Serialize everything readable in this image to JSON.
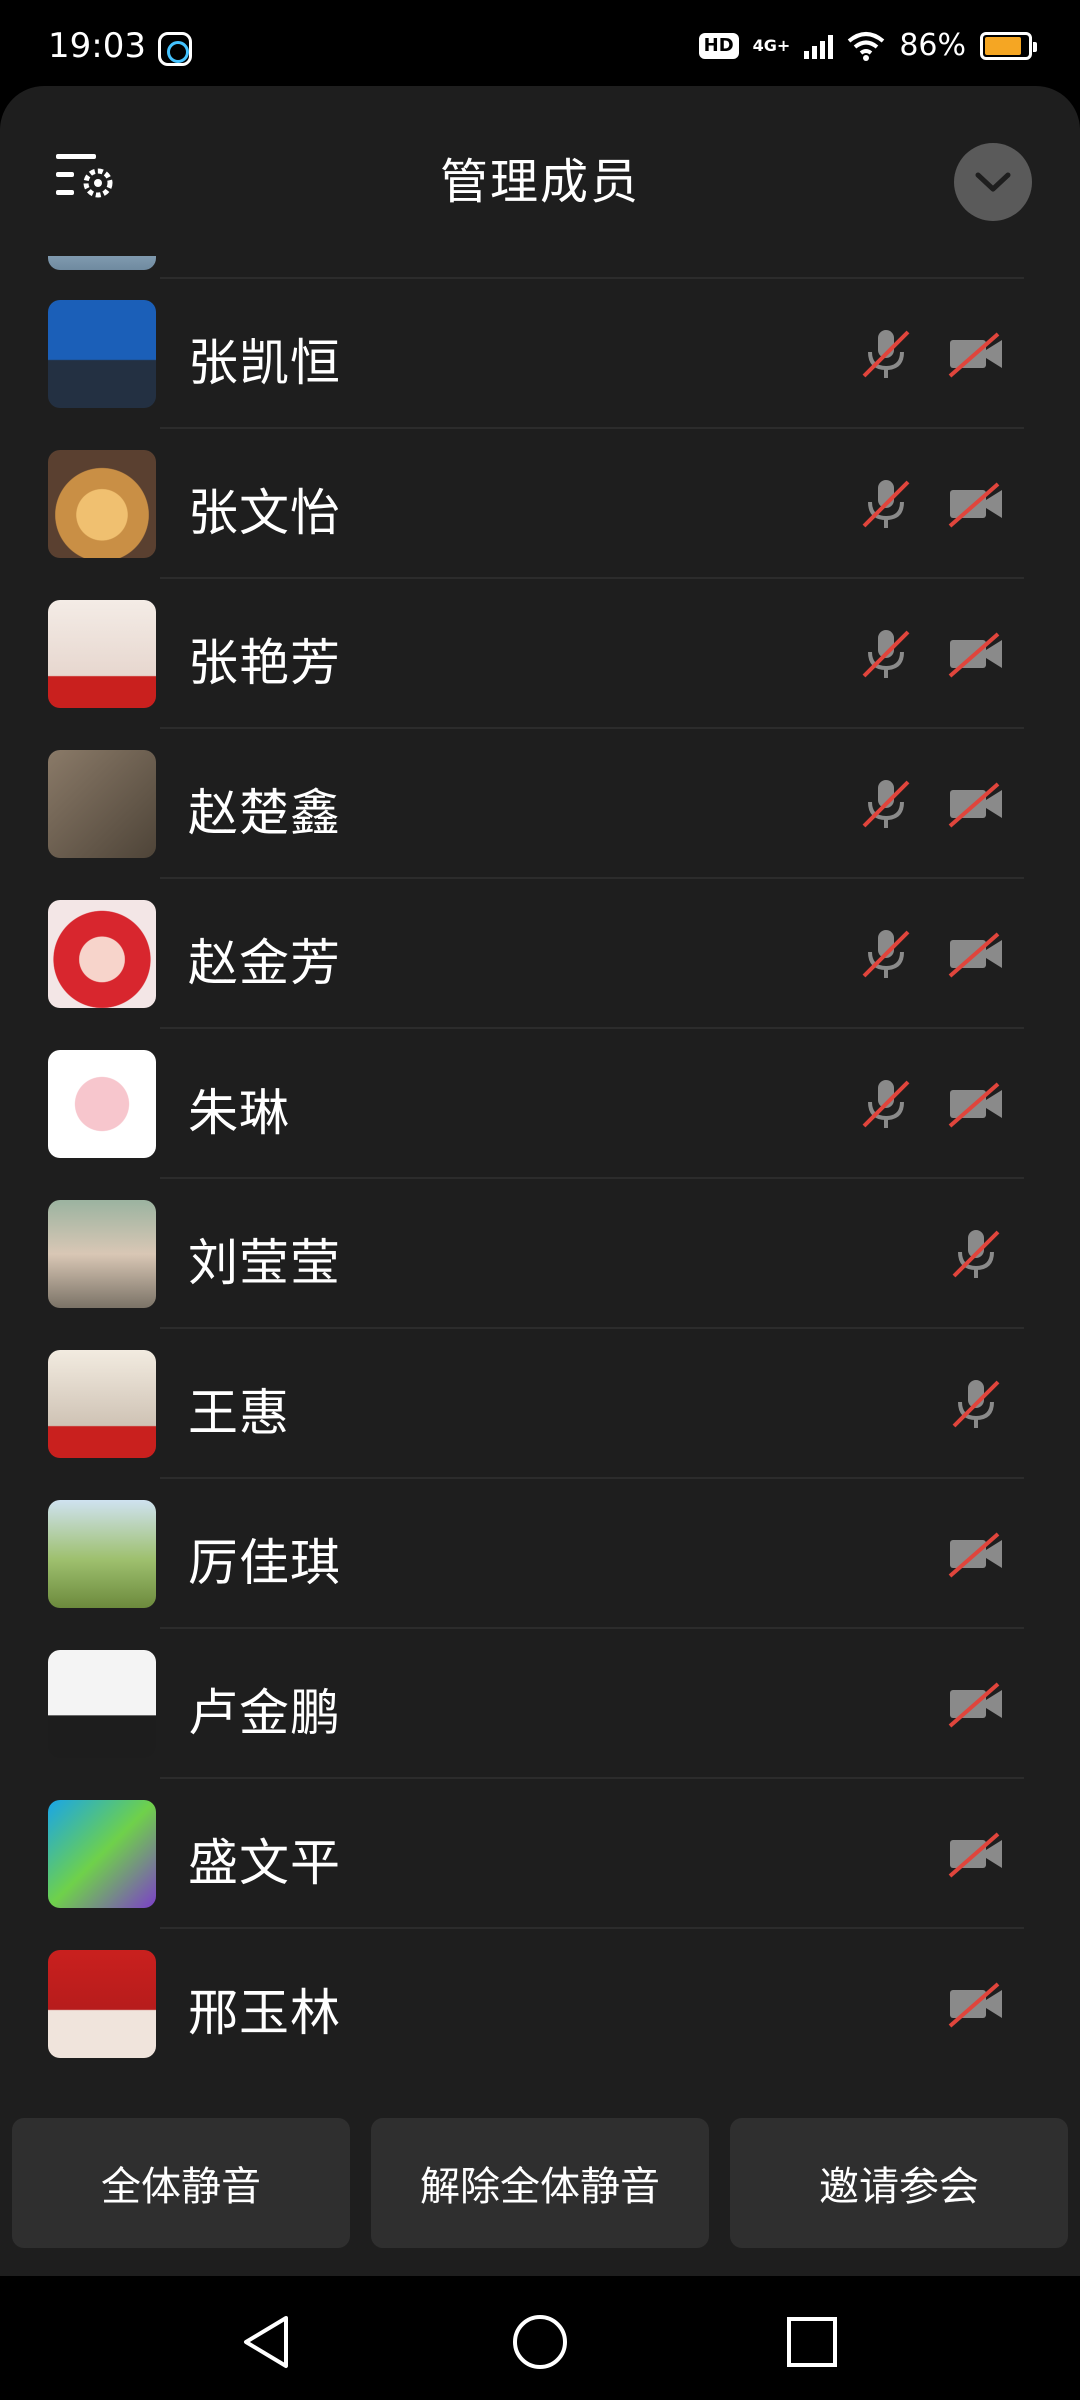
{
  "status_bar": {
    "time": "19:03",
    "hd": "HD",
    "network": "4G+",
    "battery": "86%",
    "battery_level": 0.86
  },
  "header": {
    "title": "管理成员",
    "settings_icon": "list-settings-icon",
    "collapse_icon": "chevron-down-icon"
  },
  "members": [
    {
      "name": "张凯恒",
      "mic_muted": true,
      "camera_off": true
    },
    {
      "name": "张文怡",
      "mic_muted": true,
      "camera_off": true
    },
    {
      "name": "张艳芳",
      "mic_muted": true,
      "camera_off": true
    },
    {
      "name": "赵楚鑫",
      "mic_muted": true,
      "camera_off": true
    },
    {
      "name": "赵金芳",
      "mic_muted": true,
      "camera_off": true
    },
    {
      "name": "朱琳",
      "mic_muted": true,
      "camera_off": true
    },
    {
      "name": "刘莹莹",
      "mic_muted": true,
      "camera_off": false
    },
    {
      "name": "王惠",
      "mic_muted": true,
      "camera_off": false
    },
    {
      "name": "厉佳琪",
      "mic_muted": false,
      "camera_off": true
    },
    {
      "name": "卢金鹏",
      "mic_muted": false,
      "camera_off": true
    },
    {
      "name": "盛文平",
      "mic_muted": false,
      "camera_off": true
    },
    {
      "name": "邢玉林",
      "mic_muted": false,
      "camera_off": true
    }
  ],
  "actions": {
    "mute_all": "全体静音",
    "unmute_all": "解除全体静音",
    "invite": "邀请参会"
  },
  "colors": {
    "background": "#1e1e1e",
    "muted_slash": "#e0453c",
    "icon_gray": "#8a8a8a",
    "button_bg": "#2f2f2f"
  }
}
